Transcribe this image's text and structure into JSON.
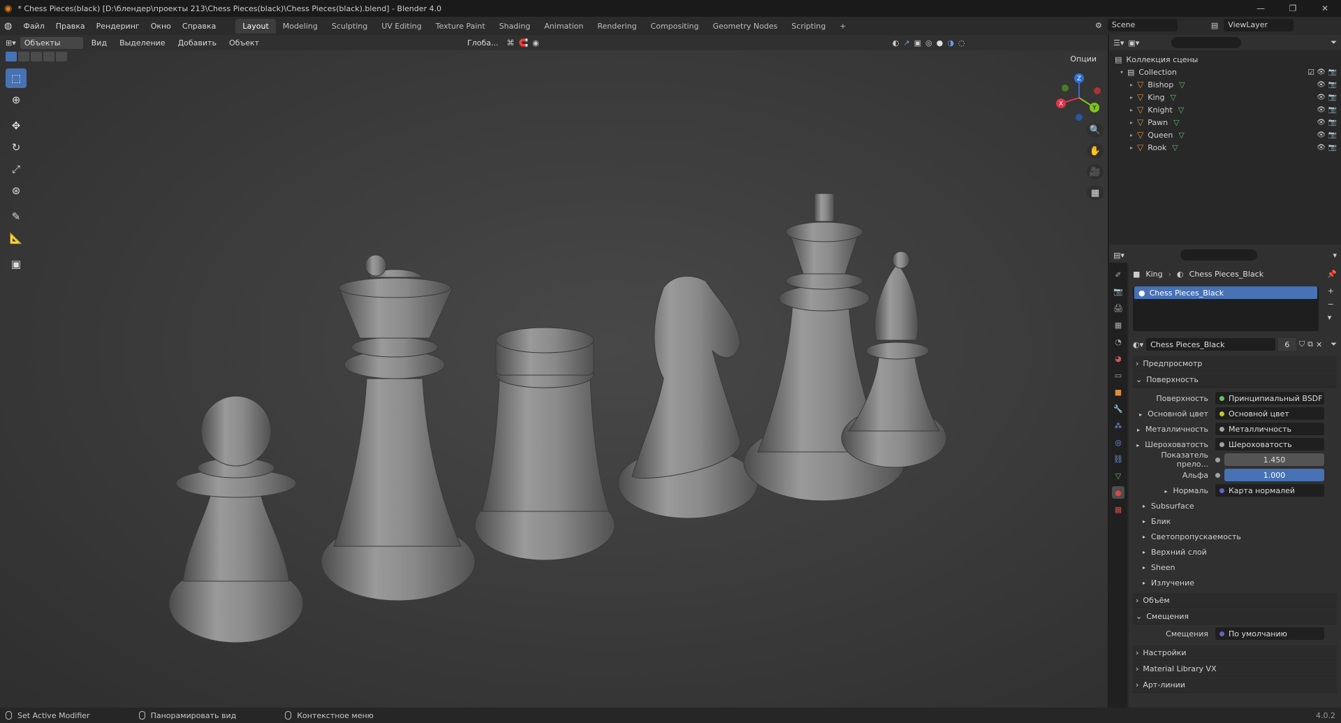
{
  "window": {
    "title": "* Chess Pieces(black) [D:\\блендер\\проекты 213\\Chess Pieces(black)\\Chess Pieces(black).blend] - Blender 4.0",
    "controls": [
      "—",
      "❐",
      "✕"
    ]
  },
  "menubar": {
    "items": [
      "Файл",
      "Правка",
      "Рендеринг",
      "Окно",
      "Справка"
    ],
    "workspaces": [
      "Layout",
      "Modeling",
      "Sculpting",
      "UV Editing",
      "Texture Paint",
      "Shading",
      "Animation",
      "Rendering",
      "Compositing",
      "Geometry Nodes",
      "Scripting"
    ],
    "active_workspace": "Layout",
    "add_tab": "+",
    "scene": "Scene",
    "view_layer": "ViewLayer"
  },
  "viewport": {
    "mode": "Объекты",
    "menus": [
      "Вид",
      "Выделение",
      "Добавить",
      "Объект"
    ],
    "transform_orientation": "Глоба...",
    "options_label": "Опции",
    "gizmo": {
      "x": "X",
      "y": "Y",
      "z": "Z"
    }
  },
  "outliner": {
    "root": "Коллекция сцены",
    "collection": "Collection",
    "objects": [
      "Bishop",
      "King",
      "Knight",
      "Pawn",
      "Queen",
      "Rook"
    ]
  },
  "properties": {
    "object": "King",
    "material": "Chess Pieces_Black",
    "material_slot": "Chess Pieces_Black",
    "users": "6",
    "panels": {
      "preview": "Предпросмотр",
      "surface": "Поверхность",
      "volume": "Объём",
      "displacement": "Смещения",
      "settings": "Настройки",
      "mlvx": "Material Library VX",
      "lineart": "Арт-линии"
    },
    "surface_rows": [
      {
        "label": "Поверхность",
        "value": "Принципиальный BSDF",
        "socket": "#62c562",
        "tri": ""
      },
      {
        "label": "Основной цвет",
        "value": "Основной цвет",
        "socket": "#c7c729",
        "tri": "▸"
      },
      {
        "label": "Металличность",
        "value": "Металличность",
        "socket": "#a1a1a1",
        "tri": "▸"
      },
      {
        "label": "Шероховатость",
        "value": "Шероховатость",
        "socket": "#a1a1a1",
        "tri": "▸"
      },
      {
        "label": "Показатель прело...",
        "value": "1.450",
        "socket": "#a1a1a1",
        "tri": "",
        "kind": "num"
      },
      {
        "label": "Альфа",
        "value": "1.000",
        "socket": "#a1a1a1",
        "tri": "",
        "kind": "blue"
      },
      {
        "label": "Нормаль",
        "value": "Карта нормалей",
        "socket": "#6363c7",
        "tri": "▸"
      }
    ],
    "subpanels": [
      "Subsurface",
      "Блик",
      "Светопропускаемость",
      "Верхний слой",
      "Sheen",
      "Излучение"
    ],
    "displacement_row": {
      "label": "Смещения",
      "value": "По умолчанию",
      "socket": "#6363c7"
    }
  },
  "statusbar": {
    "items": [
      "Set Active Modifier",
      "Панорамировать вид",
      "Контекстное меню"
    ],
    "version": "4.0.2"
  },
  "colors": {
    "accent": "#4772b3",
    "object_icon": "#e58a3a",
    "mesh_icon": "#5fbf6e"
  }
}
